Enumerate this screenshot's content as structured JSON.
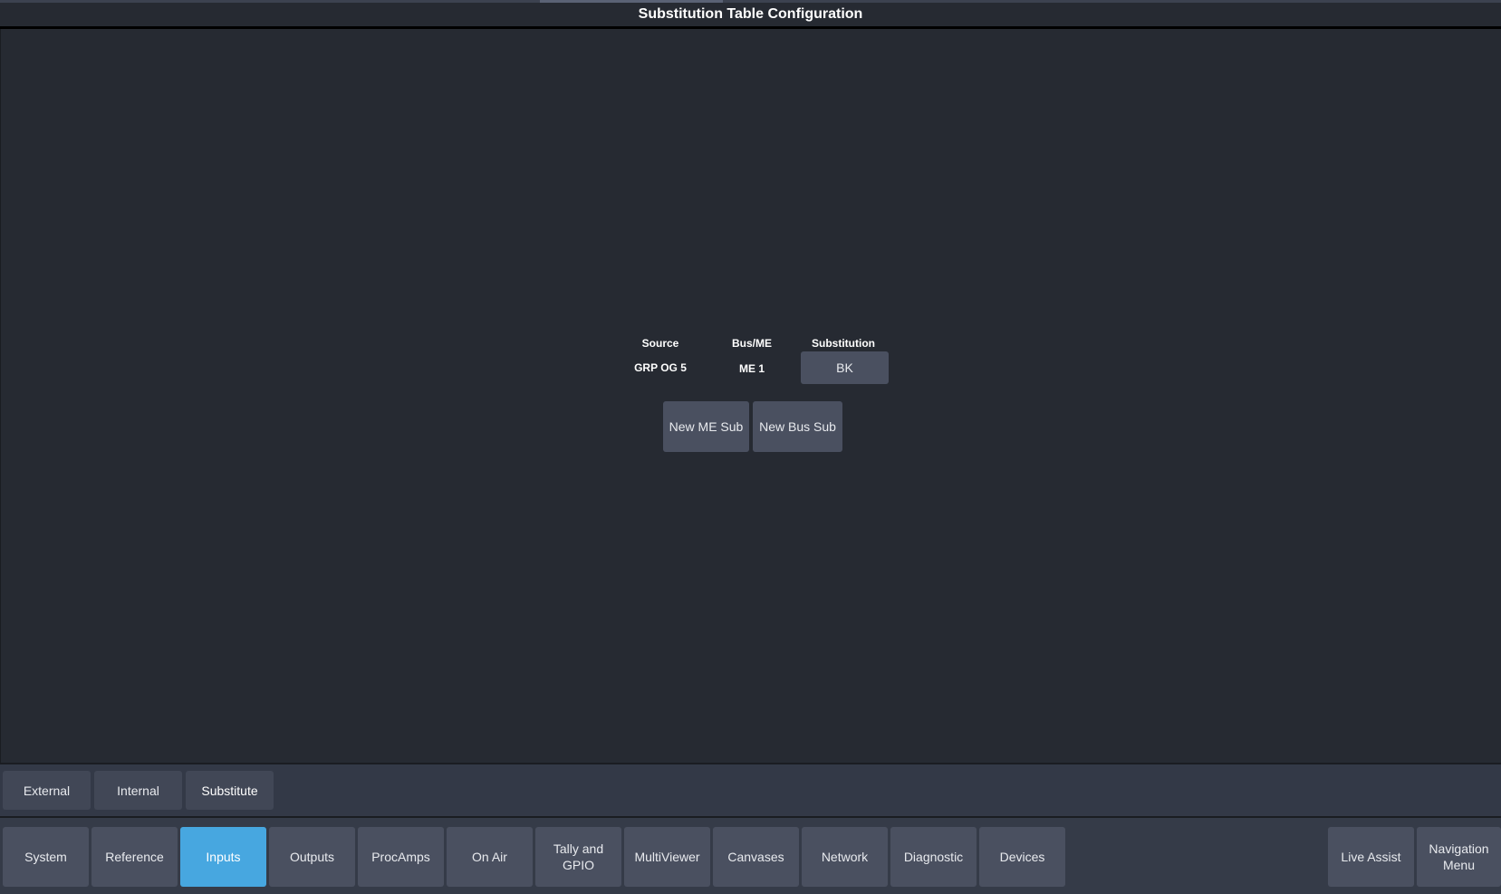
{
  "title": "Substitution Table Configuration",
  "table": {
    "headers": {
      "source": "Source",
      "bus_me": "Bus/ME",
      "substitution": "Substitution"
    },
    "row": {
      "source": "GRP OG 5",
      "bus_me": "ME 1",
      "substitution": "BK"
    }
  },
  "actions": {
    "new_me_sub": "New ME Sub",
    "new_bus_sub": "New Bus Sub"
  },
  "sub_tabs": [
    {
      "label": "External",
      "active": false
    },
    {
      "label": "Internal",
      "active": false
    },
    {
      "label": "Substitute",
      "active": true
    }
  ],
  "nav": [
    {
      "label": "System"
    },
    {
      "label": "Reference"
    },
    {
      "label": "Inputs",
      "active": true
    },
    {
      "label": "Outputs"
    },
    {
      "label": "ProcAmps"
    },
    {
      "label": "On Air"
    },
    {
      "label": "Tally and GPIO"
    },
    {
      "label": "MultiViewer"
    },
    {
      "label": "Canvases"
    },
    {
      "label": "Network"
    },
    {
      "label": "Diagnostic"
    },
    {
      "label": "Devices"
    }
  ],
  "nav_right": [
    {
      "label": "Live Assist"
    },
    {
      "label": "Navigation Menu"
    }
  ],
  "colors": {
    "accent": "#47a7e0",
    "background": "#262a32",
    "button": "#4a5060"
  }
}
